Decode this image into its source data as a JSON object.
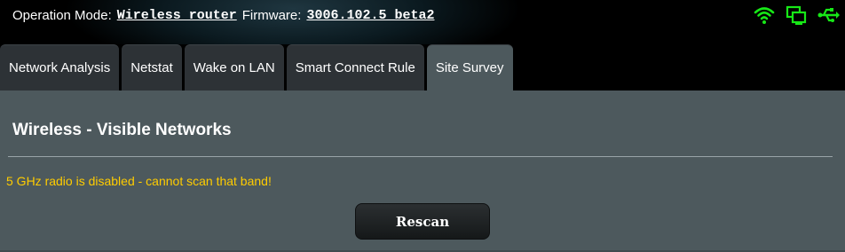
{
  "header": {
    "operation_mode_label": "Operation Mode:",
    "operation_mode_value": "Wireless router",
    "firmware_label": "Firmware:",
    "firmware_value": "3006.102.5_beta2",
    "status_icons": [
      "wifi-icon",
      "app-status-icon",
      "usb-icon"
    ],
    "status_color": "#17e817"
  },
  "tabs": [
    {
      "label": "Network Analysis",
      "active": false
    },
    {
      "label": "Netstat",
      "active": false
    },
    {
      "label": "Wake on LAN",
      "active": false
    },
    {
      "label": "Smart Connect Rule",
      "active": false
    },
    {
      "label": "Site Survey",
      "active": true
    }
  ],
  "main": {
    "title": "Wireless - Visible Networks",
    "warning": "5 GHz radio is disabled - cannot scan that band!",
    "rescan_label": "Rescan"
  },
  "colors": {
    "panel_bg": "#4d595d",
    "tab_bg": "#2d3236",
    "warning": "#ffcc00"
  }
}
